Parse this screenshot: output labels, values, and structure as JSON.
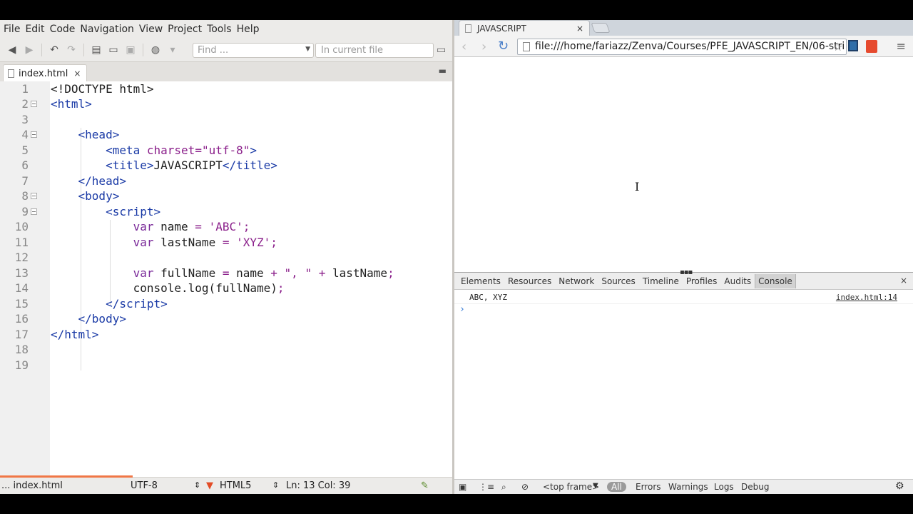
{
  "editor": {
    "menu": [
      "File",
      "Edit",
      "Code",
      "Navigation",
      "View",
      "Project",
      "Tools",
      "Help"
    ],
    "find_placeholder": "Find ...",
    "find_scope": "In current file",
    "tab_label": "index.html",
    "tab_close": "×",
    "line_numbers": [
      "1",
      "2",
      "3",
      "4",
      "5",
      "6",
      "7",
      "8",
      "9",
      "10",
      "11",
      "12",
      "13",
      "14",
      "15",
      "16",
      "17",
      "18",
      "19"
    ],
    "status": {
      "file": "... index.html",
      "encoding": "UTF-8",
      "syntax": "HTML5",
      "position": "Ln: 13 Col: 39"
    }
  },
  "browser": {
    "tab_title": "JAVASCRIPT",
    "tab_close": "×",
    "url": "file:///home/fariazz/Zenva/Courses/PFE_JAVASCRIPT_EN/06-stri",
    "devtools": {
      "tabs": [
        "Elements",
        "Resources",
        "Network",
        "Sources",
        "Timeline",
        "Profiles",
        "Audits",
        "Console"
      ],
      "active_tab": "Console",
      "close": "×",
      "console_output": "ABC, XYZ",
      "console_source": "index.html:14",
      "prompt": "›",
      "frame": "<top frame>",
      "filter_all": "All",
      "filters": [
        "Errors",
        "Warnings",
        "Logs",
        "Debug"
      ]
    }
  },
  "icons": {
    "back": "arrow-left-icon",
    "forward": "arrow-right-icon",
    "undo": "undo-icon",
    "redo": "redo-icon",
    "new": "new-file-icon",
    "open": "open-folder-icon",
    "save": "save-icon",
    "globe": "globe-icon",
    "reload": "reload-icon",
    "star": "star-icon",
    "gear": "gear-icon"
  },
  "colors": {
    "tag": "#1a3aa6",
    "attr": "#8a1e8a",
    "accent": "#f07746"
  }
}
